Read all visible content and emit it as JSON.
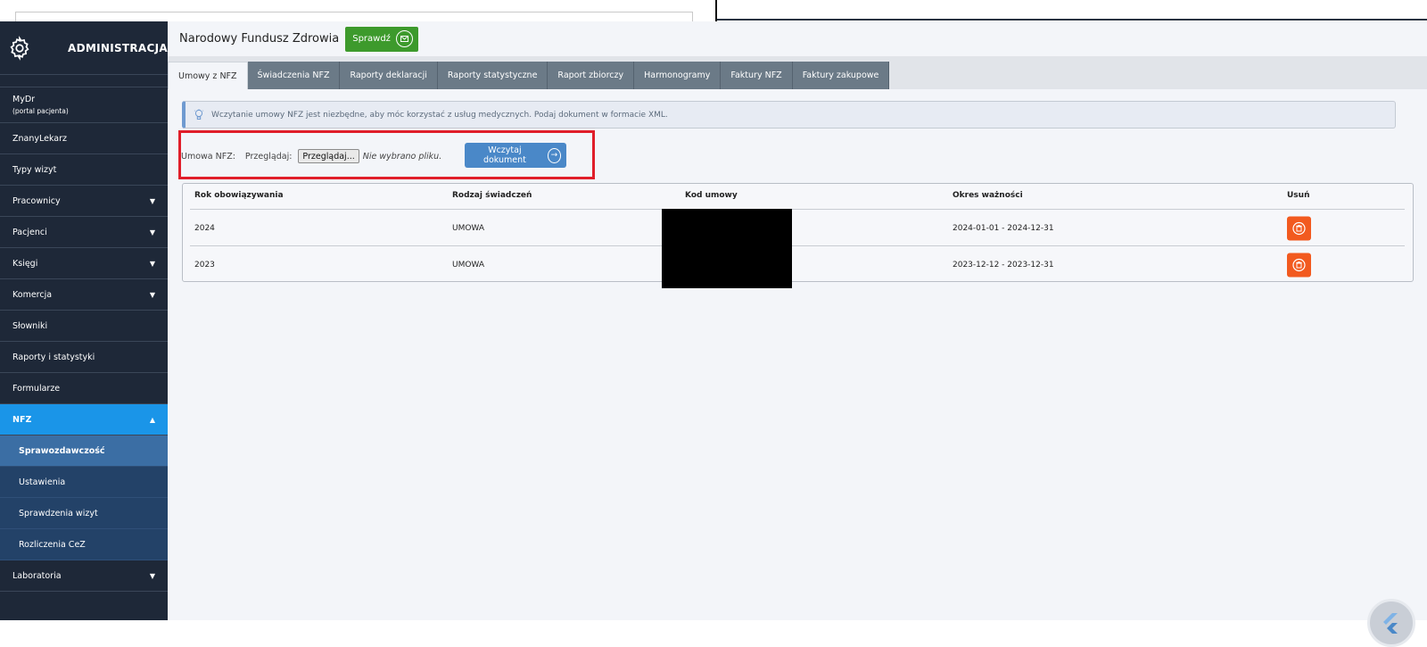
{
  "sidebar": {
    "title": "ADMINISTRACJA",
    "items": [
      {
        "label": "MyDr",
        "sub": "(portal pacjenta)",
        "arrow": ""
      },
      {
        "label": "ZnanyLekarz",
        "arrow": ""
      },
      {
        "label": "Typy wizyt",
        "arrow": ""
      },
      {
        "label": "Pracownicy",
        "arrow": "▼"
      },
      {
        "label": "Pacjenci",
        "arrow": "▼"
      },
      {
        "label": "Księgi",
        "arrow": "▼"
      },
      {
        "label": "Komercja",
        "arrow": "▼"
      },
      {
        "label": "Słowniki",
        "arrow": ""
      },
      {
        "label": "Raporty i statystyki",
        "arrow": ""
      },
      {
        "label": "Formularze",
        "arrow": ""
      },
      {
        "label": "NFZ",
        "arrow": "▲"
      },
      {
        "label": "Laboratoria",
        "arrow": "▼"
      }
    ],
    "nfz_sub": [
      "Sprawozdawczość",
      "Ustawienia",
      "Sprawdzenia wizyt",
      "Rozliczenia CeZ"
    ]
  },
  "header": {
    "title": "Narodowy Fundusz Zdrowia",
    "check_label": "Sprawdź"
  },
  "tabs": [
    "Umowy z NFZ",
    "Świadczenia NFZ",
    "Raporty deklaracji",
    "Raporty statystyczne",
    "Raport zbiorczy",
    "Harmonogramy",
    "Faktury NFZ",
    "Faktury zakupowe"
  ],
  "info": "Wczytanie umowy NFZ jest niezbędne, aby móc korzystać z usług medycznych. Podaj dokument w formacie XML.",
  "upload": {
    "label": "Umowa NFZ:",
    "browse_label": "Przeglądaj:",
    "file_button": "Przeglądaj...",
    "no_file": "Nie wybrano pliku.",
    "load_button": "Wczytaj dokument"
  },
  "table": {
    "headers": [
      "Rok obowiązywania",
      "Rodzaj świadczeń",
      "Kod umowy",
      "Okres ważności",
      "Usuń"
    ],
    "rows": [
      {
        "year": "2024",
        "type": "UMOWA",
        "code": "",
        "period": "2024-01-01 - 2024-12-31"
      },
      {
        "year": "2023",
        "type": "UMOWA",
        "code": "",
        "period": "2023-12-12 - 2023-12-31"
      }
    ]
  },
  "colors": {
    "sidebar_bg": "#1e2838",
    "active_nav": "#1a95e8",
    "sub_nav": "#234268",
    "check_button": "#3d9a2c",
    "load_button": "#4a88c8",
    "delete_button": "#f25a1f",
    "highlight_box": "#e01e2a"
  }
}
